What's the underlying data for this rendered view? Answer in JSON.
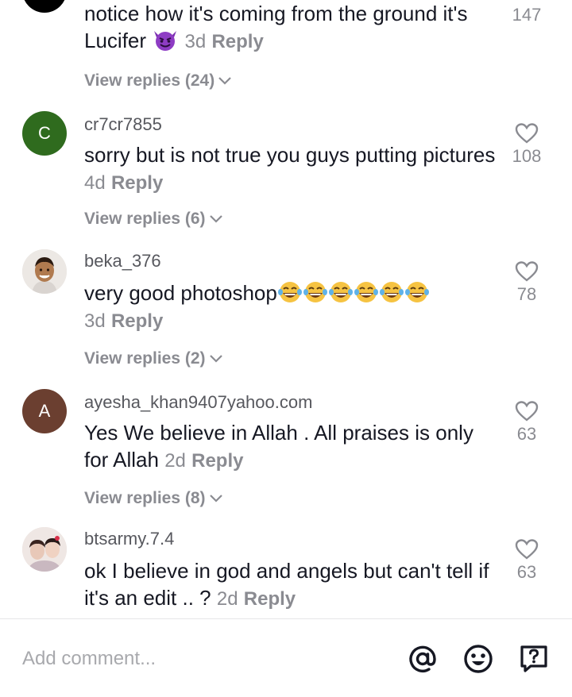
{
  "comments": [
    {
      "username": "",
      "text": "notice how it's coming from the ground it's Lucifer",
      "emoji": "devil-emoji",
      "age": "3d",
      "reply_label": "Reply",
      "view_replies": "View replies (24)",
      "likes": "147",
      "avatar_color": "#000000"
    },
    {
      "username": "cr7cr7855",
      "text": "sorry but is not true you guys putting pictures",
      "age": "4d",
      "reply_label": "Reply",
      "view_replies": "View replies (6)",
      "likes": "108",
      "avatar_letter": "C",
      "avatar_color": "#2f6b1e"
    },
    {
      "username": "beka_376",
      "text": "very good photoshop",
      "emoji": "laughing-tears-emoji",
      "emoji_count": 6,
      "age": "3d",
      "reply_label": "Reply",
      "view_replies": "View replies (2)",
      "likes": "78",
      "avatar_type": "photo"
    },
    {
      "username": "ayesha_khan9407yahoo.com",
      "text": "Yes We believe in Allah . All praises is only for Allah",
      "age": "2d",
      "reply_label": "Reply",
      "view_replies": "View replies (8)",
      "likes": "63",
      "avatar_letter": "A",
      "avatar_color": "#6b3f30"
    },
    {
      "username": "btsarmy.7.4",
      "text": "ok I believe in god and angels but can't tell if it's an edit .. ?",
      "age": "2d",
      "reply_label": "Reply",
      "likes": "63",
      "avatar_type": "photo"
    }
  ],
  "composer": {
    "placeholder": "Add comment...",
    "icons": [
      "at-mention-icon",
      "emoji-face-icon",
      "question-icon"
    ]
  },
  "colors": {
    "text": "#161823",
    "muted": "#8a8b91",
    "divider": "#e6e6e8"
  }
}
